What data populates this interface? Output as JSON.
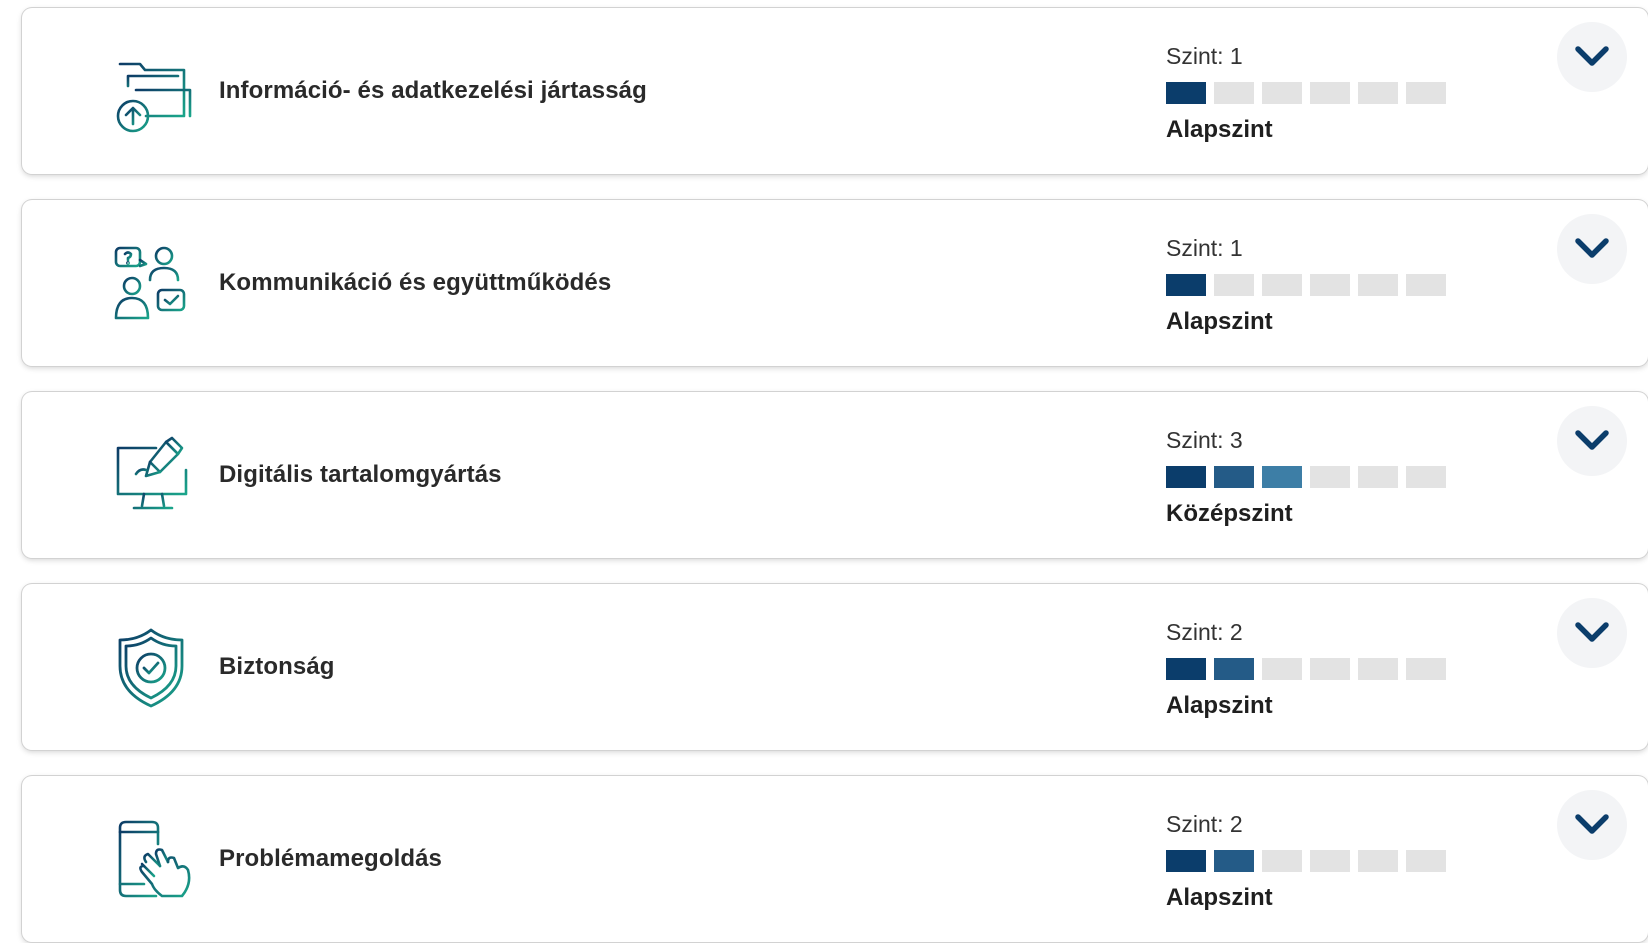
{
  "colors": {
    "filled_1": "#0b3d6b",
    "filled_2": "#245b87",
    "filled_3": "#3d7ea6",
    "empty": "#e3e3e3",
    "chevron": "#0b3d6b",
    "icon_gradient_start": "#0d3b66",
    "icon_gradient_end": "#1aa58a"
  },
  "level_segments_total": 6,
  "competences": [
    {
      "icon": "folder-upload-icon",
      "title": "Információ- és adatkezelési jártasság",
      "level_label": "Szint: 1",
      "level_value": 1,
      "level_name": "Alapszint"
    },
    {
      "icon": "people-communication-icon",
      "title": "Kommunikáció és együttműködés",
      "level_label": "Szint: 1",
      "level_value": 1,
      "level_name": "Alapszint"
    },
    {
      "icon": "monitor-brush-icon",
      "title": "Digitális tartalomgyártás",
      "level_label": "Szint: 3",
      "level_value": 3,
      "level_name": "Középszint"
    },
    {
      "icon": "shield-check-icon",
      "title": "Biztonság",
      "level_label": "Szint: 2",
      "level_value": 2,
      "level_name": "Alapszint"
    },
    {
      "icon": "phone-touch-icon",
      "title": "Problémamegoldás",
      "level_label": "Szint: 2",
      "level_value": 2,
      "level_name": "Alapszint"
    }
  ]
}
